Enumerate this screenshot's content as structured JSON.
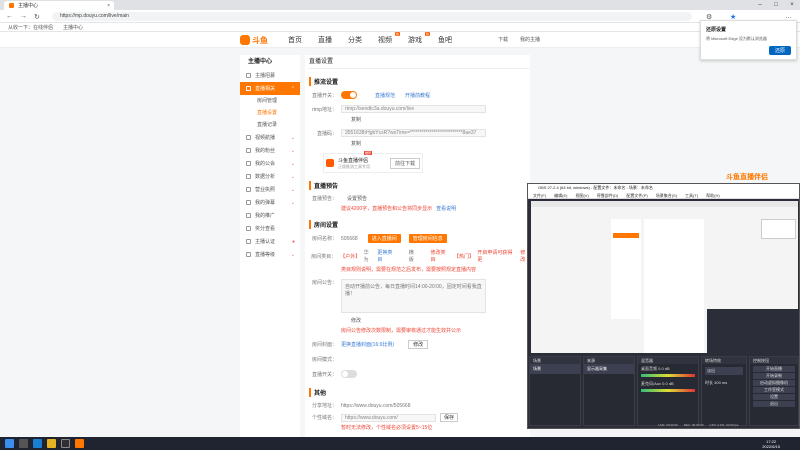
{
  "browser": {
    "tab_title": "主播中心",
    "url": "https://mp.douyu.com/live/main",
    "bookmarks": [
      "从收一下：在线伴侣",
      "主播中心"
    ]
  },
  "site": {
    "logo_text": "斗鱼",
    "nav": [
      "首页",
      "直播",
      "分类",
      "视频",
      "游戏",
      "鱼吧"
    ],
    "hot": [
      "热",
      "热"
    ],
    "right": [
      "下载",
      "我的主播"
    ]
  },
  "sidebar": {
    "title": "主播中心",
    "items": [
      {
        "label": "主播招募",
        "active": false
      },
      {
        "label": "直播相关",
        "active": true
      }
    ],
    "subs": [
      {
        "label": "房间管理",
        "active": false
      },
      {
        "label": "直播设置",
        "active": true
      },
      {
        "label": "直播记录",
        "active": false
      }
    ],
    "items2": [
      "视频航播",
      "我的粉丝",
      "我的公会",
      "数据分析",
      "营业执照",
      "我的弹幕",
      "我的推广",
      "奖分查看",
      "主播认证",
      "直播等级"
    ]
  },
  "main": {
    "page_title": "直播设置",
    "s1": "推流设置",
    "push_switch_label": "直播开关：",
    "push_link1": "直播规范",
    "push_link2": "开播前教程",
    "rtmp_label": "rtmp地址：",
    "rtmp_value": "rtmp://sendtc3a.douyu.com/live",
    "copy1": "复制",
    "code_label": "直播码：",
    "code_value": "3551638rHgbYcsR?wsTime=***************************8ae37",
    "copy2": "复制",
    "promo_title": "斗鱼直播伴侣",
    "promo_sub": "正版推流工具专用",
    "promo_hot": "推荐",
    "promo_btn": "前往下载",
    "s2": "直播预告",
    "preview_label": "直播预告：",
    "preview_val": "设置预告",
    "preview_tip": "建议4200字，直播预告和公告将同步显示",
    "preview_link": "查看说明",
    "s3": "房间设置",
    "room_name_label": "房间名称：",
    "room_name": "505668",
    "room_btn1": "进入直播间",
    "room_btn2": "管理房间信息",
    "cat_label": "房间类目：",
    "cat_values": [
      "【户外】",
      "华为",
      "更换类目",
      "横版",
      "修改类目",
      "【热门】",
      "开启申请可获得更",
      "修改"
    ],
    "cat_tip": "类目规则说明，需要在规范之后发布，需要按照规定直播内容",
    "notice_label": "房间公告：",
    "notice_text": "自动开播前公告，每日直播时间14:00-20:00，固定时间看我直播！",
    "notice_edit": "修改",
    "notice_tip": "房间公告修改次数限制，需要审核通过才能生效并公示",
    "cover_label": "房间封面：",
    "cover_link": "更换直播封面(16:9比例)",
    "cover_btn": "修改",
    "danmu_label": "房间模式：",
    "stream_label": "直播开关：",
    "s4": "其他",
    "share_label": "分享地址：",
    "share_val": "https://www.douyu.com/505668",
    "custom_label": "个性域名：",
    "custom_val": "https://www.douyu.com/",
    "custom_btn": "保存",
    "custom_tip": "暂时无法修改，个性域名必须设置5~15位"
  },
  "obs": {
    "title": "OBS 27.2.4 (64 bit, windows) - 配置文件：未命名 - 场景：未命名",
    "menu": [
      "文件(F)",
      "编辑(E)",
      "视图(V)",
      "停靠部件(D)",
      "配置文件(P)",
      "场景集合(S)",
      "工具(T)",
      "帮助(H)"
    ],
    "docks": [
      "场景",
      "来源",
      "混音器",
      "转场特效",
      "控制按钮"
    ],
    "scene": "场景",
    "source": "显示器采集",
    "mixer": [
      "桌面音频",
      "麦克风/Aux"
    ],
    "db": [
      "0.0 dB",
      "0.0 dB"
    ],
    "transition": "淡出",
    "dur_label": "时长",
    "dur": "300 ms",
    "controls": [
      "开始直播",
      "开始录制",
      "启动虚拟摄像机",
      "工作室模式",
      "设置",
      "退出"
    ],
    "status": [
      "LIVE: 00:00:00",
      "REC: 00:00:00",
      "CPU: 2.6%, 30.00 fps"
    ]
  },
  "notification": {
    "title": "还原设置",
    "text": "将 Microsoft Edge 设为默认浏览器",
    "btn": "还原"
  },
  "banner": "斗鱼直播伴侣",
  "taskbar": {
    "time": "17:22",
    "date": "2022/6/15"
  },
  "colors": {
    "accent": "#ff7700",
    "link": "#3a7bd5"
  }
}
